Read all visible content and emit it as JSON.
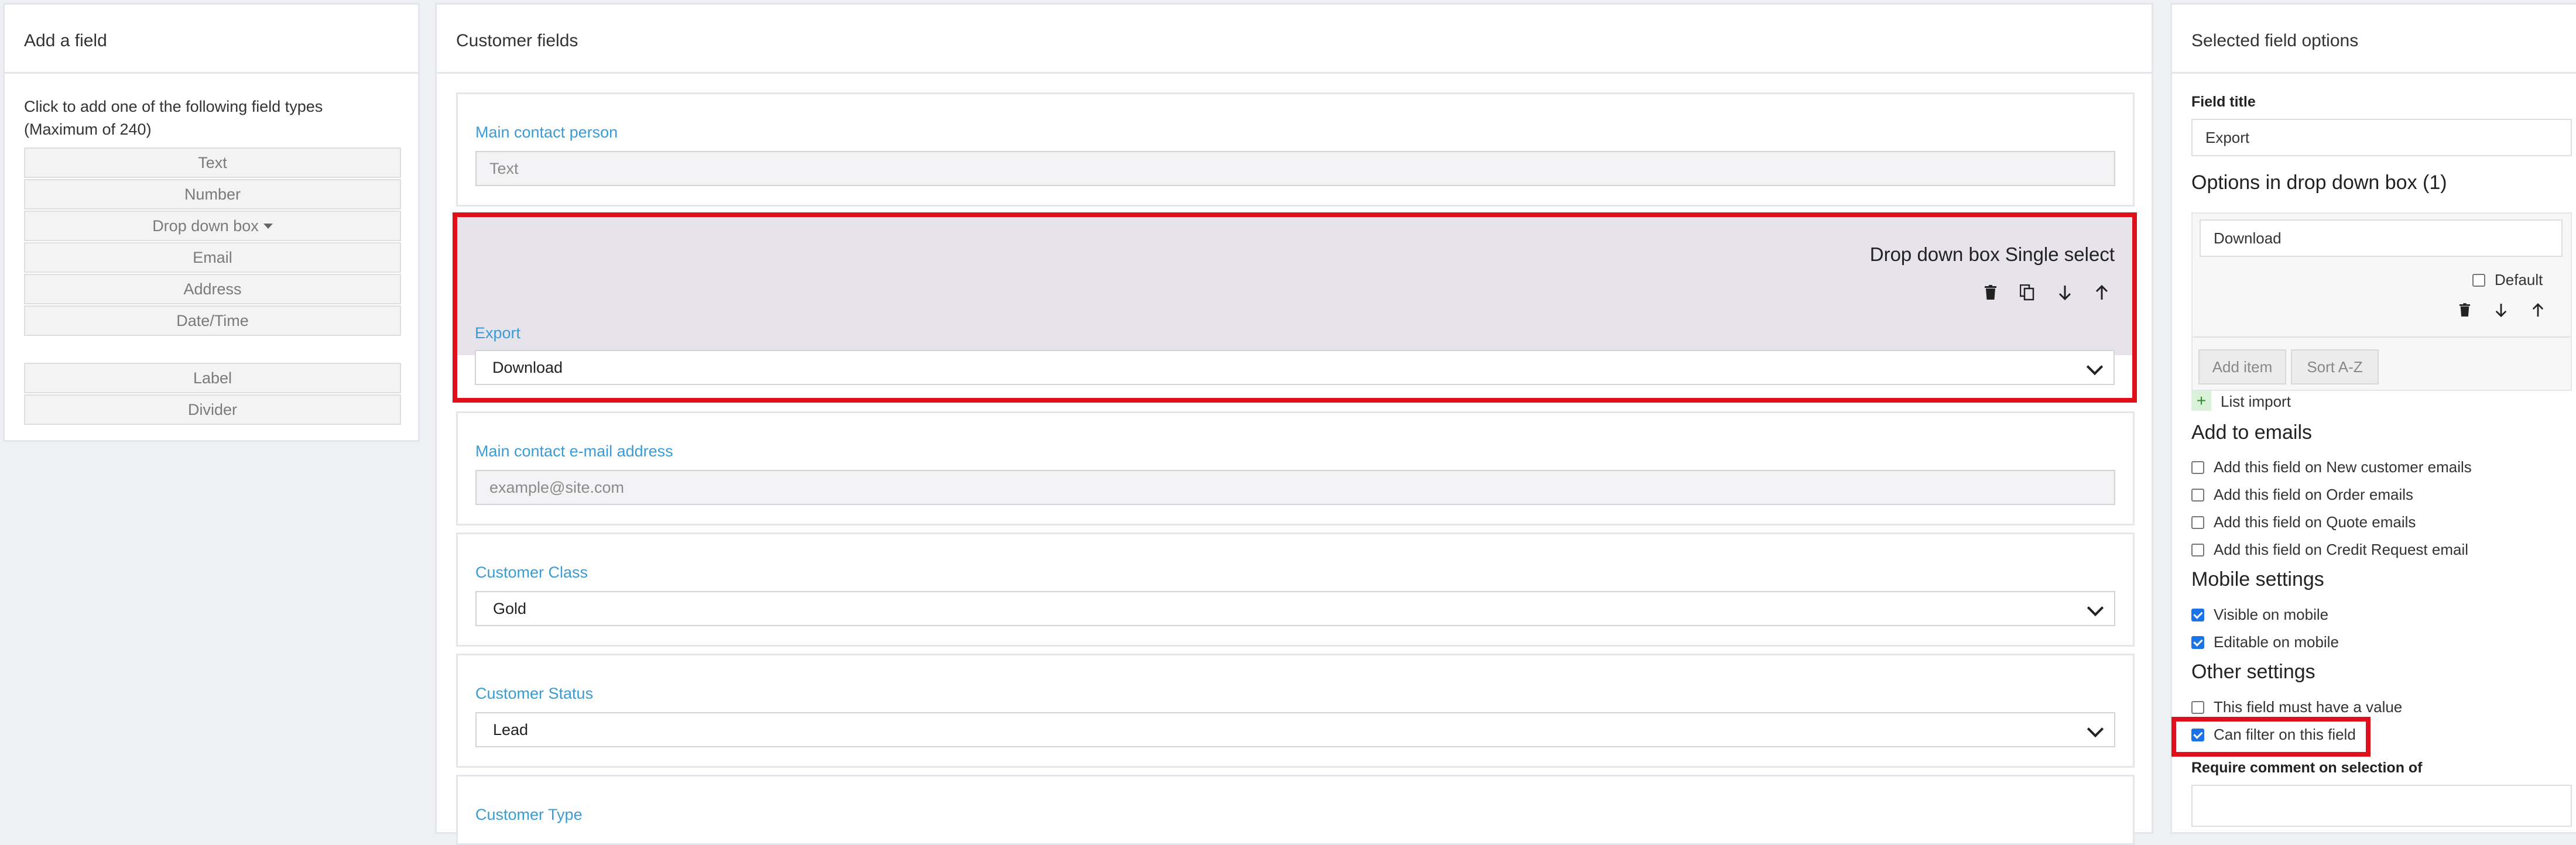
{
  "left": {
    "title": "Add a field",
    "hint": "Click to add one of the following field types (Maximum of 240)",
    "types": [
      "Text",
      "Number",
      "Drop down box",
      "Email",
      "Address",
      "Date/Time"
    ],
    "extras": [
      "Label",
      "Divider"
    ]
  },
  "middle": {
    "title": "Customer fields",
    "main_contact": {
      "label": "Main contact person",
      "placeholder": "Text"
    },
    "selected": {
      "heading": "Drop down box Single select",
      "label": "Export",
      "value": "Download",
      "tools": [
        "trash-icon",
        "copy-icon",
        "arrow-down-icon",
        "arrow-up-icon"
      ]
    },
    "email": {
      "label": "Main contact e-mail address",
      "placeholder": "example@site.com"
    },
    "customer_class": {
      "label": "Customer Class",
      "value": "Gold"
    },
    "customer_status": {
      "label": "Customer Status",
      "value": "Lead"
    },
    "customer_type": {
      "label": "Customer Type"
    }
  },
  "right": {
    "title": "Selected field options",
    "field_title_label": "Field title",
    "field_title_value": "Export",
    "options_heading": "Options in drop down box (1)",
    "option_value": "Download",
    "default_label": "Default",
    "add_item": "Add item",
    "sort_az": "Sort A-Z",
    "list_import": "List import",
    "emails_heading": "Add to emails",
    "emails": [
      {
        "label": "Add this field on New customer emails",
        "checked": false
      },
      {
        "label": "Add this field on Order emails",
        "checked": false
      },
      {
        "label": "Add this field on Quote emails",
        "checked": false
      },
      {
        "label": "Add this field on Credit Request email",
        "checked": false
      }
    ],
    "mobile_heading": "Mobile settings",
    "mobile": [
      {
        "label": "Visible on mobile",
        "checked": true
      },
      {
        "label": "Editable on mobile",
        "checked": true
      }
    ],
    "other_heading": "Other settings",
    "other": [
      {
        "label": "This field must have a value",
        "checked": false
      },
      {
        "label": "Can filter on this field",
        "checked": true
      }
    ],
    "require_comment_label": "Require comment on selection of"
  },
  "colors": {
    "accent_blue": "#3a9bd5",
    "highlight_red": "#e0101a",
    "checkbox_blue": "#1a73e8"
  }
}
